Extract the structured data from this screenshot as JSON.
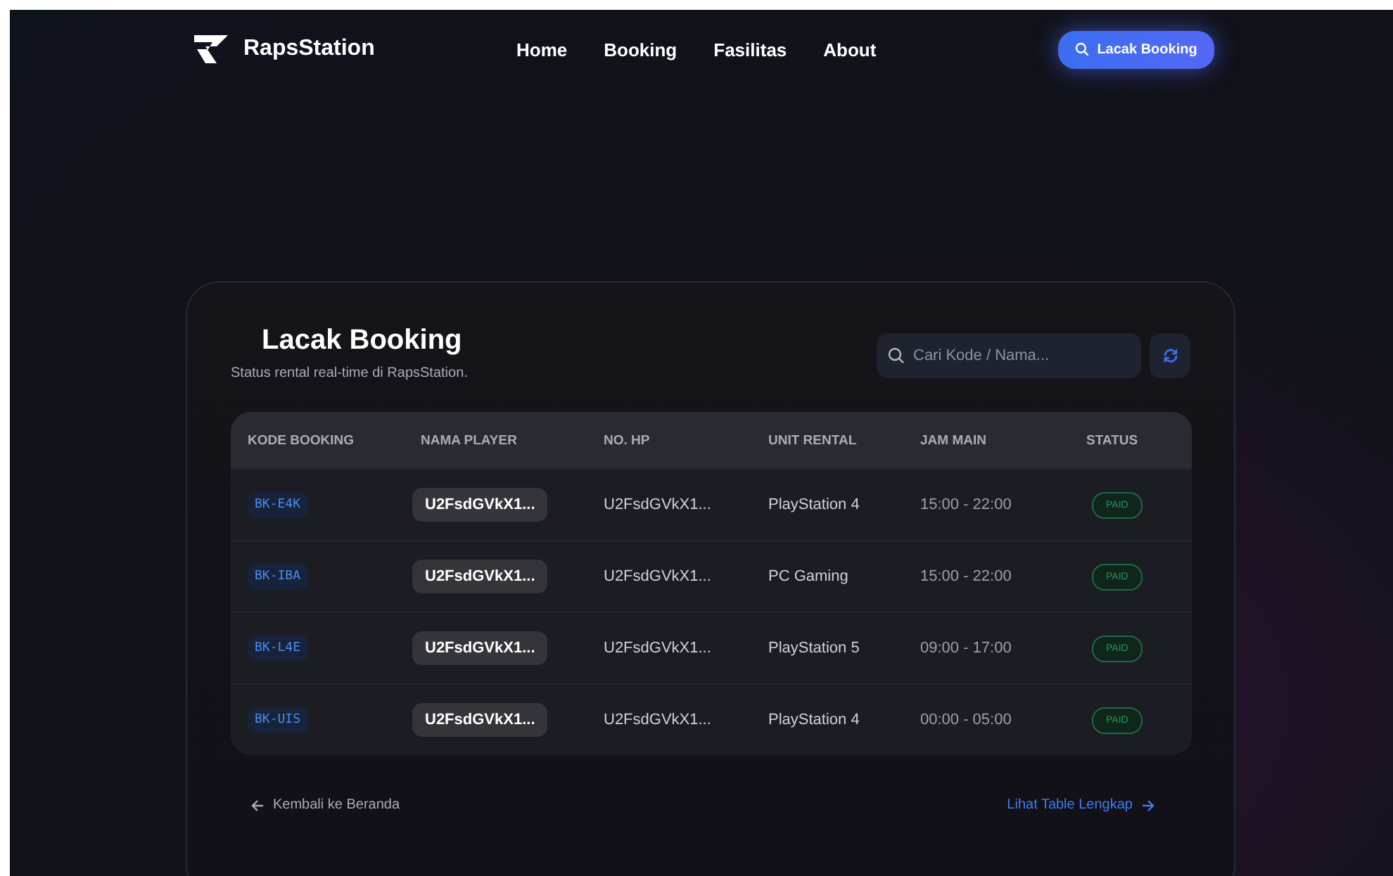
{
  "navbar": {
    "brand": "RapsStation",
    "links": [
      "Home",
      "Booking",
      "Fasilitas",
      "About"
    ],
    "cta": "Lacak Booking"
  },
  "panel": {
    "title": "Lacak Booking",
    "subtitle": "Status rental real-time di RapsStation.",
    "search": {
      "placeholder": "Cari Kode / Nama..."
    }
  },
  "table": {
    "columns": [
      "KODE BOOKING",
      "NAMA PLAYER",
      "NO. HP",
      "UNIT RENTAL",
      "JAM MAIN",
      "STATUS"
    ],
    "rows": [
      {
        "code": "BK-E4K",
        "player": "U2FsdGVkX1...",
        "phone": "U2FsdGVkX1...",
        "unit": "PlayStation 4",
        "time": "15:00 - 22:00",
        "status": "PAID"
      },
      {
        "code": "BK-IBA",
        "player": "U2FsdGVkX1...",
        "phone": "U2FsdGVkX1...",
        "unit": "PC Gaming",
        "time": "15:00 - 22:00",
        "status": "PAID"
      },
      {
        "code": "BK-L4E",
        "player": "U2FsdGVkX1...",
        "phone": "U2FsdGVkX1...",
        "unit": "PlayStation 5",
        "time": "09:00 - 17:00",
        "status": "PAID"
      },
      {
        "code": "BK-UIS",
        "player": "U2FsdGVkX1...",
        "phone": "U2FsdGVkX1...",
        "unit": "PlayStation 4",
        "time": "00:00 - 05:00",
        "status": "PAID"
      }
    ]
  },
  "footer": {
    "back": "Kembali ke Beranda",
    "more": "Lihat Table Lengkap"
  }
}
